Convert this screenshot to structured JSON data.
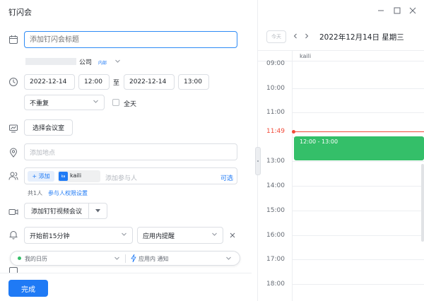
{
  "window": {
    "title": "钉闪会"
  },
  "form": {
    "title_placeholder": "添加钉闪会标题",
    "org_name": "公司",
    "org_badge": "内部",
    "start_date": "2022-12-14",
    "start_time": "12:00",
    "to_label": "至",
    "end_date": "2022-12-14",
    "end_time": "13:00",
    "repeat": "不重复",
    "allday_label": "全天",
    "room_button": "选择会议室",
    "location_placeholder": "添加地点",
    "add_label": "+ 添加",
    "participant_name": "kaili",
    "participant_avatar": "ka",
    "participant_placeholder": "添加参与人",
    "optional_label": "可选",
    "count_label": "共1人",
    "permission_link": "参与人权限设置",
    "video_button": "添加钉钉视频会议",
    "reminder_time": "开始前15分钟",
    "reminder_type": "应用内提醒",
    "calendar_name": "我的日历",
    "notify_label": "应用内 通知",
    "done_button": "完成"
  },
  "calendar": {
    "today_button": "今天",
    "date_title": "2022年12月14日 星期三",
    "column_user": "kaili",
    "hours": [
      "09:00",
      "10:00",
      "11:00",
      "13:00",
      "14:00",
      "15:00",
      "16:00",
      "17:00",
      "18:00"
    ],
    "now_time": "11:49",
    "event_time": "12:00 - 13:00"
  },
  "colors": {
    "accent": "#1f7af5",
    "event": "#34bf69",
    "now": "#f24a39"
  }
}
